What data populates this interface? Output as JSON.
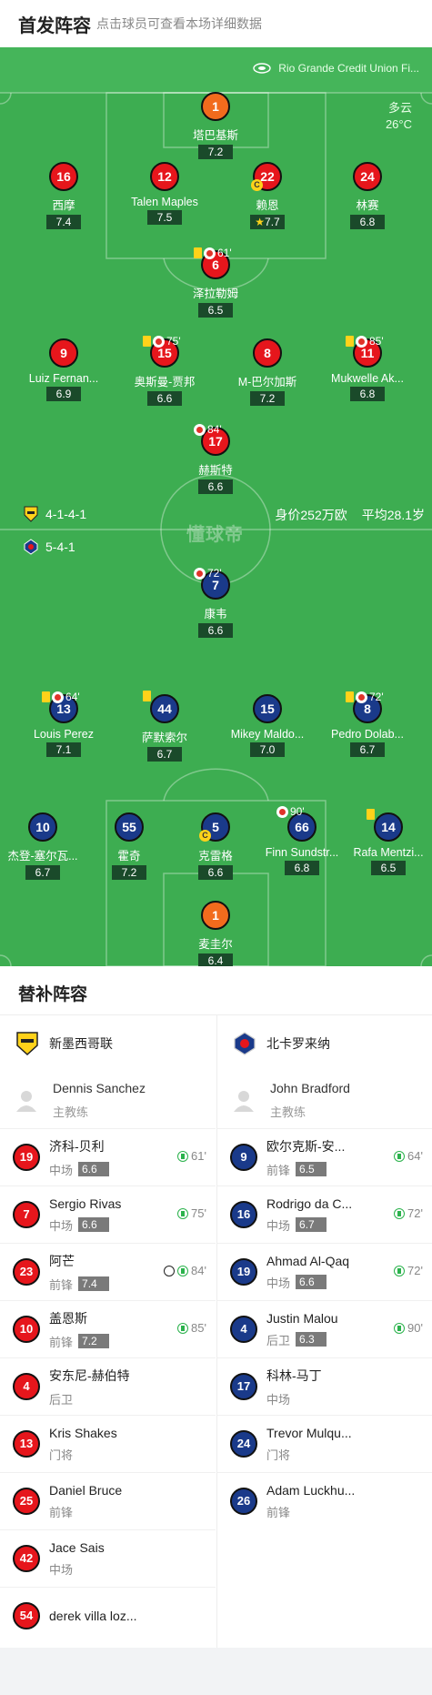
{
  "header": {
    "title": "首发阵容",
    "subtitle": "点击球员可查看本场详细数据"
  },
  "pitch": {
    "stadium": "Rio Grande Credit Union Fi...",
    "weather": "多云",
    "temperature": "26°C",
    "watermark": "懂球帝",
    "home_formation": "4-1-4-1",
    "away_formation": "5-4-1",
    "value": "身价252万欧",
    "avg_age": "平均28.1岁",
    "colors": {
      "pitch": "#3dad51",
      "home": "#e6161c",
      "away": "#1a3a8a",
      "keeper": "#f26b1d"
    }
  },
  "home_players": [
    {
      "num": "1",
      "name": "塔巴基斯",
      "rating": "7.2"
    },
    {
      "num": "16",
      "name": "西摩",
      "rating": "7.4"
    },
    {
      "num": "12",
      "name": "Talen Maples",
      "rating": "7.5"
    },
    {
      "num": "22",
      "name": "赖恩",
      "rating": "7.7",
      "captain": "C"
    },
    {
      "num": "24",
      "name": "林赛",
      "rating": "6.8"
    },
    {
      "num": "6",
      "name": "泽拉勒姆",
      "rating": "6.5",
      "minute": "61'"
    },
    {
      "num": "9",
      "name": "Luiz Fernan...",
      "rating": "6.9"
    },
    {
      "num": "15",
      "name": "奥斯曼-贾邦",
      "rating": "6.6",
      "minute": "75'"
    },
    {
      "num": "8",
      "name": "M-巴尔加斯",
      "rating": "7.2"
    },
    {
      "num": "11",
      "name": "Mukwelle Ak...",
      "rating": "6.8",
      "minute": "85'"
    },
    {
      "num": "17",
      "name": "赫斯特",
      "rating": "6.6",
      "minute": "84'"
    }
  ],
  "away_players": [
    {
      "num": "7",
      "name": "康韦",
      "rating": "6.6",
      "minute": "72'"
    },
    {
      "num": "13",
      "name": "Louis Perez",
      "rating": "7.1",
      "minute": "64'"
    },
    {
      "num": "44",
      "name": "萨默索尔",
      "rating": "6.7"
    },
    {
      "num": "15",
      "name": "Mikey Maldo...",
      "rating": "7.0"
    },
    {
      "num": "8",
      "name": "Pedro Dolab...",
      "rating": "6.7",
      "minute": "72'"
    },
    {
      "num": "10",
      "name": "杰登-塞尔瓦...",
      "rating": "6.7"
    },
    {
      "num": "55",
      "name": "霍奇",
      "rating": "7.2"
    },
    {
      "num": "5",
      "name": "克雷格",
      "rating": "6.6",
      "captain": "C"
    },
    {
      "num": "66",
      "name": "Finn Sundstr...",
      "rating": "6.8",
      "minute": "90'"
    },
    {
      "num": "14",
      "name": "Rafa Mentzi...",
      "rating": "6.5"
    },
    {
      "num": "1",
      "name": "麦圭尔",
      "rating": "6.4"
    }
  ],
  "bench": {
    "title": "替补阵容",
    "home": {
      "team": "新墨西哥联",
      "coach": {
        "name": "Dennis Sanchez",
        "role": "主教练"
      },
      "subs": [
        {
          "num": "19",
          "name": "济科-贝利",
          "pos": "中场",
          "rating": "6.6",
          "minute": "61'"
        },
        {
          "num": "7",
          "name": "Sergio Rivas",
          "pos": "中场",
          "rating": "6.6",
          "minute": "75'"
        },
        {
          "num": "23",
          "name": "阿芒",
          "pos": "前锋",
          "rating": "7.4",
          "minute": "84'",
          "goal": true
        },
        {
          "num": "10",
          "name": "盖恩斯",
          "pos": "前锋",
          "rating": "7.2",
          "minute": "85'"
        },
        {
          "num": "4",
          "name": "安东尼-赫伯特",
          "pos": "后卫"
        },
        {
          "num": "13",
          "name": "Kris Shakes",
          "pos": "门将"
        },
        {
          "num": "25",
          "name": "Daniel Bruce",
          "pos": "前锋"
        },
        {
          "num": "42",
          "name": "Jace Sais",
          "pos": "中场"
        },
        {
          "num": "54",
          "name": "derek villa loz..."
        }
      ]
    },
    "away": {
      "team": "北卡罗来纳",
      "coach": {
        "name": "John Bradford",
        "role": "主教练"
      },
      "subs": [
        {
          "num": "9",
          "name": "欧尔克斯-安...",
          "pos": "前锋",
          "rating": "6.5",
          "minute": "64'"
        },
        {
          "num": "16",
          "name": "Rodrigo da C...",
          "pos": "中场",
          "rating": "6.7",
          "minute": "72'"
        },
        {
          "num": "19",
          "name": "Ahmad Al-Qaq",
          "pos": "中场",
          "rating": "6.6",
          "minute": "72'"
        },
        {
          "num": "4",
          "name": "Justin Malou",
          "pos": "后卫",
          "rating": "6.3",
          "minute": "90'"
        },
        {
          "num": "17",
          "name": "科林-马丁",
          "pos": "中场"
        },
        {
          "num": "24",
          "name": "Trevor Mulqu...",
          "pos": "门将"
        },
        {
          "num": "26",
          "name": "Adam Luckhu...",
          "pos": "前锋"
        }
      ]
    }
  }
}
